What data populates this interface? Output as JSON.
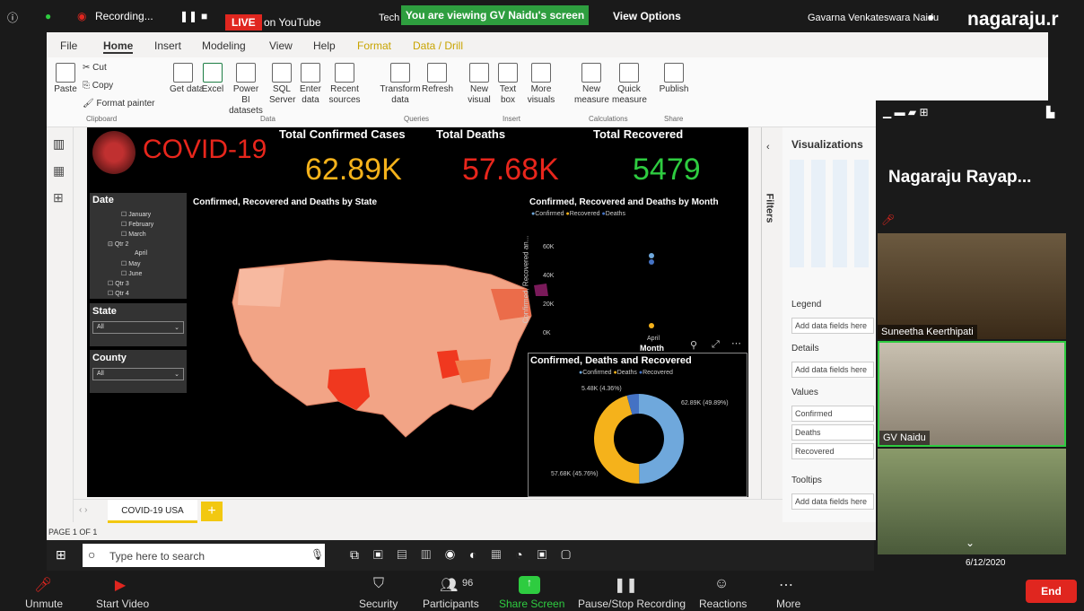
{
  "zoom_top": {
    "recording_label": "Recording...",
    "live_label": "LIVE",
    "stream_target": "on YouTube",
    "window_title_partial": "Tech",
    "viewing_banner": "You are viewing GV Naidu's screen",
    "view_options": "View Options",
    "host_name": "Gavarna Venkateswara Naidu",
    "watermark": "nagaraju.r"
  },
  "pbi": {
    "menu": [
      "File",
      "Home",
      "Insert",
      "Modeling",
      "View",
      "Help",
      "Format",
      "Data / Drill"
    ],
    "ribbon": {
      "paste": "Paste",
      "cut": "Cut",
      "copy": "Copy",
      "format_painter": "Format painter",
      "get_data": "Get data",
      "excel": "Excel",
      "powerbi_datasets": "Power BI datasets",
      "sql_server": "SQL Server",
      "enter_data": "Enter data",
      "recent_sources": "Recent sources",
      "transform_data": "Transform data",
      "refresh": "Refresh",
      "new_visual": "New visual",
      "text_box": "Text box",
      "more_visuals": "More visuals",
      "new_measure": "New measure",
      "quick_measure": "Quick measure",
      "publish": "Publish",
      "groups": [
        "Clipboard",
        "Data",
        "Queries",
        "Insert",
        "Calculations",
        "Share"
      ]
    },
    "report": {
      "logo_text": "COVID-19",
      "kpis": [
        {
          "title": "Total Confirmed Cases",
          "value": "62.89K",
          "color": "#f5b21b"
        },
        {
          "title": "Total Deaths",
          "value": "57.68K",
          "color": "#e8261c"
        },
        {
          "title": "Total Recovered",
          "value": "5479",
          "color": "#2ecc40"
        }
      ],
      "map_title": "Confirmed, Recovered and Deaths by State",
      "date_slicer": {
        "title": "Date",
        "items": [
          "January",
          "February",
          "March",
          "Qtr 2",
          "April",
          "May",
          "June",
          "Qtr 3",
          "Qtr 4"
        ]
      },
      "state_slicer": {
        "title": "State",
        "value": "All"
      },
      "county_slicer": {
        "title": "County",
        "value": "All"
      },
      "month_chart": {
        "title": "Confirmed, Recovered and Deaths by Month",
        "legend": [
          "Confirmed",
          "Recovered",
          "Deaths"
        ],
        "ylabel": "Confirmed, Recovered an...",
        "yticks": [
          "60K",
          "40K",
          "20K",
          "0K"
        ],
        "xtick": "April",
        "xlabel": "Month"
      },
      "donut": {
        "title": "Confirmed, Deaths and Recovered",
        "legend": [
          "Confirmed",
          "Deaths",
          "Recovered"
        ],
        "labels": [
          "5.48K (4.36%)",
          "62.89K (49.89%)",
          "57.68K (45.76%)"
        ]
      }
    },
    "tabs": [
      "COVID-19 USA"
    ],
    "page_label": "PAGE 1 OF 1",
    "filters_label": "Filters",
    "viz": {
      "title": "Visualizations",
      "legend_label": "Legend",
      "add_fields": "Add data fields here",
      "details_label": "Details",
      "values_label": "Values",
      "values": [
        "Confirmed",
        "Deaths",
        "Recovered"
      ],
      "tooltips_label": "Tooltips"
    }
  },
  "chart_data": [
    {
      "type": "scatter",
      "title": "Confirmed, Recovered and Deaths by Month",
      "categories": [
        "April"
      ],
      "series": [
        {
          "name": "Confirmed",
          "values": [
            62890
          ]
        },
        {
          "name": "Recovered",
          "values": [
            5479
          ]
        },
        {
          "name": "Deaths",
          "values": [
            57680
          ]
        }
      ],
      "ylim": [
        0,
        70000
      ]
    },
    {
      "type": "pie",
      "title": "Confirmed, Deaths and Recovered",
      "categories": [
        "Confirmed",
        "Deaths",
        "Recovered"
      ],
      "values": [
        62890,
        57680,
        5479
      ],
      "percent": [
        49.89,
        45.76,
        4.36
      ]
    }
  ],
  "video": {
    "speaker": "Nagaraju Rayap...",
    "participants": [
      "Suneetha Keerthipati",
      "GV Naidu"
    ]
  },
  "taskbar": {
    "search_placeholder": "Type here to search",
    "date": "6/12/2020"
  },
  "zoom_bottom": {
    "unmute": "Unmute",
    "start_video": "Start Video",
    "security": "Security",
    "participants": "Participants",
    "participant_count": "96",
    "share_screen": "Share Screen",
    "pause_recording": "Pause/Stop Recording",
    "reactions": "Reactions",
    "more": "More",
    "end": "End"
  }
}
